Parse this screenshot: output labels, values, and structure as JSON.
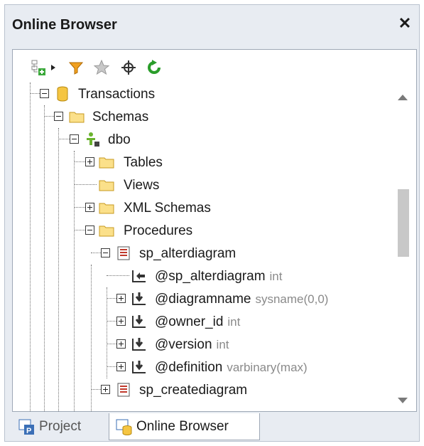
{
  "window": {
    "title": "Online Browser",
    "close_icon": "close-icon"
  },
  "toolbar": {
    "buttons": [
      {
        "name": "add-connection-button",
        "icon": "add-connection-icon"
      },
      {
        "name": "dropdown-arrow",
        "icon": "triangle-right-icon"
      },
      {
        "name": "filter-button",
        "icon": "filter-icon"
      },
      {
        "name": "favorites-button",
        "icon": "star-icon"
      },
      {
        "name": "locate-button",
        "icon": "crosshair-icon"
      },
      {
        "name": "refresh-button",
        "icon": "refresh-icon"
      }
    ]
  },
  "tree": [
    {
      "label": "Transactions",
      "icon": "database-icon",
      "toggle": "minus"
    },
    {
      "label": "Schemas",
      "icon": "folder-icon",
      "toggle": "minus"
    },
    {
      "label": "dbo",
      "icon": "user-schema-icon",
      "toggle": "minus"
    },
    {
      "label": "Tables",
      "icon": "folder-icon",
      "toggle": "plus"
    },
    {
      "label": "Views",
      "icon": "folder-icon",
      "toggle": "none"
    },
    {
      "label": "XML Schemas",
      "icon": "folder-icon",
      "toggle": "plus"
    },
    {
      "label": "Procedures",
      "icon": "folder-icon",
      "toggle": "minus"
    },
    {
      "label": "sp_alterdiagram",
      "icon": "procedure-icon",
      "toggle": "minus"
    },
    {
      "label": "@sp_alterdiagram",
      "type": "int",
      "icon": "return-param-icon",
      "toggle": "none"
    },
    {
      "label": "@diagramname",
      "type": "sysname(0,0)",
      "icon": "input-param-icon",
      "toggle": "plus"
    },
    {
      "label": "@owner_id",
      "type": "int",
      "icon": "input-param-icon",
      "toggle": "plus"
    },
    {
      "label": "@version",
      "type": "int",
      "icon": "input-param-icon",
      "toggle": "plus"
    },
    {
      "label": "@definition",
      "type": "varbinary(max)",
      "icon": "input-param-icon",
      "toggle": "plus"
    },
    {
      "label": "sp_creatediagram",
      "icon": "procedure-icon",
      "toggle": "plus"
    }
  ],
  "tabs": [
    {
      "label": "Project",
      "icon": "project-icon",
      "active": false
    },
    {
      "label": "Online Browser",
      "icon": "online-browser-icon",
      "active": true
    }
  ],
  "colors": {
    "panel_bg": "#e8ecf2",
    "folder": "#f5c542",
    "refresh": "#2a9d2a",
    "filter": "#e08a00"
  }
}
